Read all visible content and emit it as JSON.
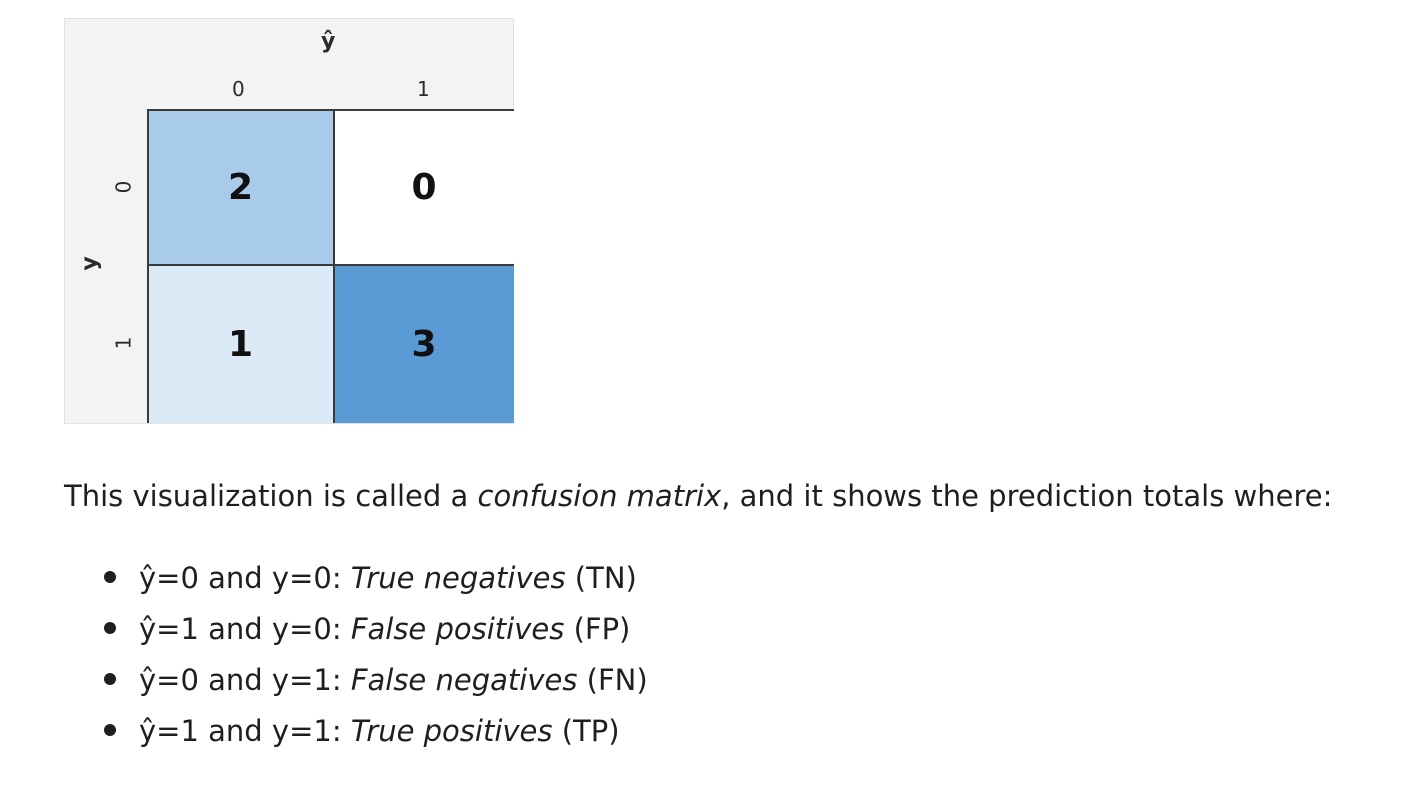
{
  "figure": {
    "pred_axis_label": "ŷ",
    "true_axis_label": "y",
    "col_ticks": [
      "0",
      "1"
    ],
    "row_ticks": [
      "0",
      "1"
    ],
    "cells": [
      {
        "row": 0,
        "col": 0,
        "value": "2",
        "color": "#a9cbea"
      },
      {
        "row": 0,
        "col": 1,
        "value": "0",
        "color": "#ffffff"
      },
      {
        "row": 1,
        "col": 0,
        "value": "1",
        "color": "#dce9f6"
      },
      {
        "row": 1,
        "col": 1,
        "value": "3",
        "color": "#5b9bd5"
      }
    ]
  },
  "text": {
    "intro_before": "This visualization is called a ",
    "intro_emph": "confusion matrix",
    "intro_after": ", and it shows the prediction totals where:"
  },
  "defs": [
    {
      "condition": "ŷ=0 and y=0: ",
      "term": "True negatives",
      "abbr": " (TN)"
    },
    {
      "condition": "ŷ=1 and y=0: ",
      "term": "False positives",
      "abbr": " (FP)"
    },
    {
      "condition": "ŷ=0 and y=1: ",
      "term": "False negatives",
      "abbr": " (FN)"
    },
    {
      "condition": "ŷ=1 and y=1: ",
      "term": "True positives",
      "abbr": " (TP)"
    }
  ]
}
